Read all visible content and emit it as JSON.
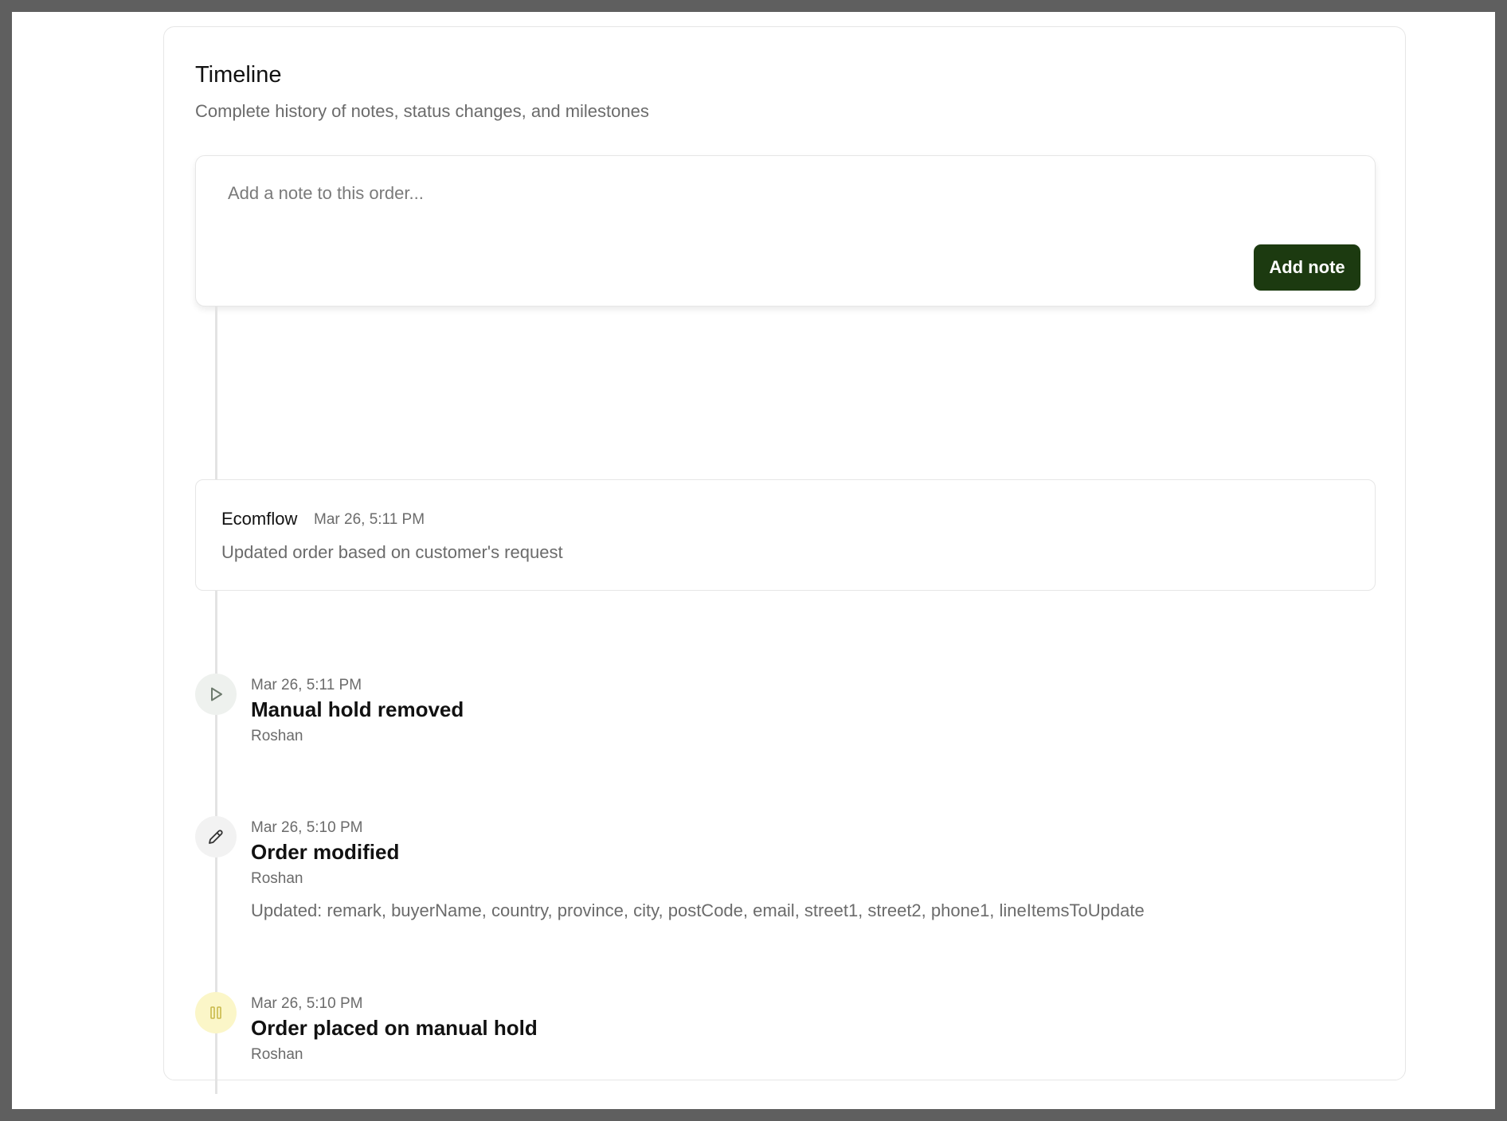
{
  "timeline": {
    "title": "Timeline",
    "subtitle": "Complete history of notes, status changes, and milestones"
  },
  "composer": {
    "placeholder": "Add a note to this order...",
    "button_label": "Add note"
  },
  "note": {
    "author": "Ecomflow",
    "time": "Mar 26, 5:11 PM",
    "body": "Updated order based on customer's request"
  },
  "events": [
    {
      "icon": "play-icon",
      "time": "Mar 26, 5:11 PM",
      "title": "Manual hold removed",
      "user": "Roshan",
      "icon_bg": "#eef1ee",
      "icon_color": "#6d7a6d"
    },
    {
      "icon": "pencil-icon",
      "time": "Mar 26, 5:10 PM",
      "title": "Order modified",
      "user": "Roshan",
      "detail": "Updated: remark, buyerName, country, province, city, postCode, email, street1, street2, phone1, lineItemsToUpdate",
      "icon_bg": "#f2f2f2",
      "icon_color": "#333333"
    },
    {
      "icon": "pause-icon",
      "time": "Mar 26, 5:10 PM",
      "title": "Order placed on manual hold",
      "user": "Roshan",
      "icon_bg": "#fbf6c8",
      "icon_color": "#c9b94a"
    }
  ],
  "colors": {
    "primary_button": "#1c3a10",
    "backdrop": "#5f5f5f"
  }
}
